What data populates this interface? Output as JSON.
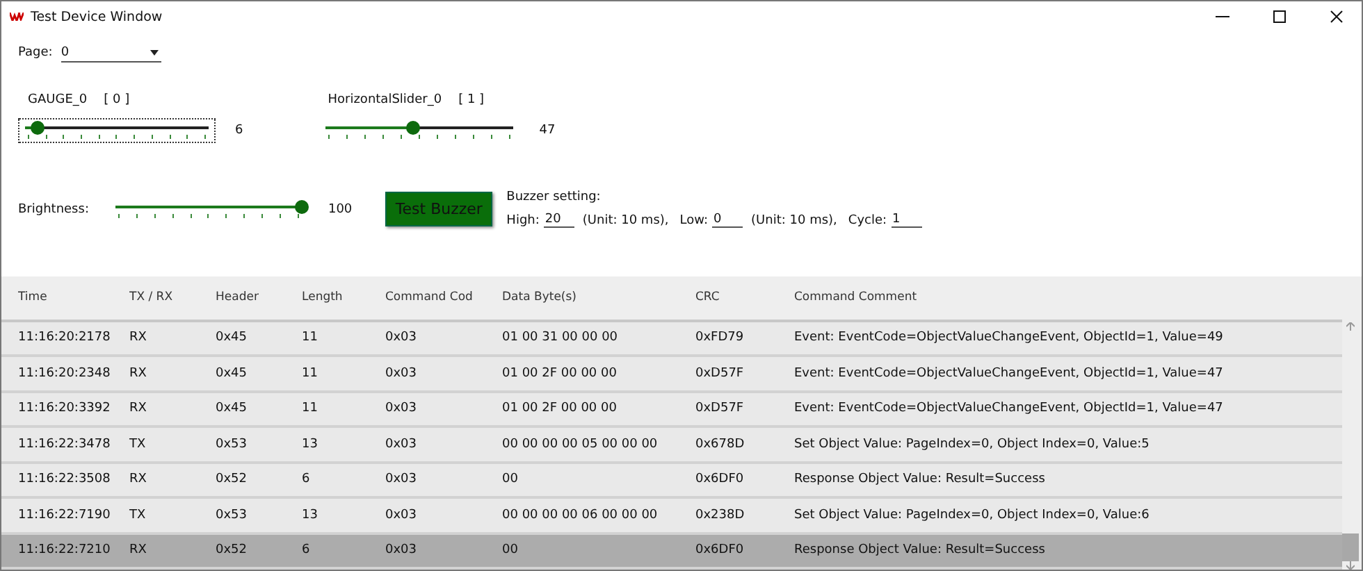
{
  "window": {
    "title": "Test Device Window"
  },
  "page": {
    "label": "Page:",
    "value": "0"
  },
  "sliders": [
    {
      "label": "GAUGE_0",
      "index": "[ 0 ]",
      "level": 0.07,
      "reading": "6",
      "focused": true
    },
    {
      "label": "HorizontalSlider_0",
      "index": "[ 1 ]",
      "level": 0.47,
      "reading": "47",
      "focused": false
    }
  ],
  "brightness": {
    "label": "Brightness:",
    "level": 1,
    "reading": "100"
  },
  "test_button": "Test Buzzer",
  "buzzer": {
    "title": "Buzzer setting:",
    "high_label": "High:",
    "high": "20",
    "high_unit": "(Unit: 10 ms),",
    "low_label": "Low:",
    "low": "0",
    "low_unit": "(Unit: 10 ms),",
    "cycle_label": "Cycle:",
    "cycle": "1"
  },
  "table": {
    "columns": [
      "Time",
      "TX / RX",
      "Header",
      "Length",
      "Command Cod",
      "Data Byte(s)",
      "CRC",
      "Command Comment"
    ],
    "rows": [
      {
        "cells": [
          "11:16:20:2178",
          "RX",
          "0x45",
          "11",
          "0x03",
          "01 00 31 00 00 00",
          "0xFD79",
          "Event: EventCode=ObjectValueChangeEvent, ObjectId=1, Value=49"
        ],
        "selected": false
      },
      {
        "cells": [
          "11:16:20:2348",
          "RX",
          "0x45",
          "11",
          "0x03",
          "01 00 2F 00 00 00",
          "0xD57F",
          "Event: EventCode=ObjectValueChangeEvent, ObjectId=1, Value=47"
        ],
        "selected": false
      },
      {
        "cells": [
          "11:16:20:3392",
          "RX",
          "0x45",
          "11",
          "0x03",
          "01 00 2F 00 00 00",
          "0xD57F",
          "Event: EventCode=ObjectValueChangeEvent, ObjectId=1, Value=47"
        ],
        "selected": false
      },
      {
        "cells": [
          "11:16:22:3478",
          "TX",
          "0x53",
          "13",
          "0x03",
          "00 00 00 00 05 00 00 00",
          "0x678D",
          "Set Object Value: PageIndex=0, Object Index=0, Value:5"
        ],
        "selected": false
      },
      {
        "cells": [
          "11:16:22:3508",
          "RX",
          "0x52",
          "6",
          "0x03",
          "00",
          "0x6DF0",
          "Response Object Value: Result=Success"
        ],
        "selected": false
      },
      {
        "cells": [
          "11:16:22:7190",
          "TX",
          "0x53",
          "13",
          "0x03",
          "00 00 00 00 06 00 00 00",
          "0x238D",
          "Set Object Value: PageIndex=0, Object Index=0, Value:6"
        ],
        "selected": false
      },
      {
        "cells": [
          "11:16:22:7210",
          "RX",
          "0x52",
          "6",
          "0x03",
          "00",
          "0x6DF0",
          "Response Object Value: Result=Success"
        ],
        "selected": true
      }
    ]
  }
}
